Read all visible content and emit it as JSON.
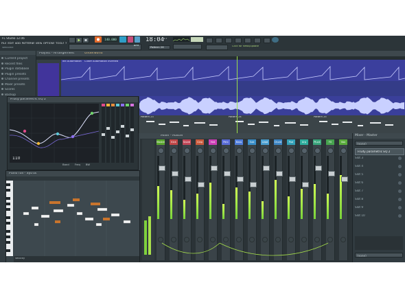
{
  "topbar": {
    "menu": [
      "FILE",
      "EDIT",
      "ADD",
      "PATTERNS",
      "VIEW",
      "OPTIONS",
      "TOOLS",
      "?"
    ],
    "project_title": "FL Studio 12.0b",
    "hint": "Welcome",
    "tempo_display": "140.000",
    "time_display": "18:04",
    "time_sub": "27",
    "pattern_label": "Pattern 26",
    "online_text": "Click for news/update"
  },
  "browser": {
    "items": [
      "Current project",
      "Recent files",
      "Plugin database",
      "Plugin presets",
      "Channel presets",
      "Mixer presets",
      "Scores",
      "Backup",
      "Clipboard files",
      "Collected",
      "Envelopes",
      "IL shared data",
      "Impulses",
      "Misc",
      "Packs",
      "Project bones",
      "Projects",
      "Recorded",
      "Rendered",
      "Sliced beats",
      "Soundfonts",
      "Speech",
      "User"
    ]
  },
  "playlist": {
    "title": "Playlist - Arrangement",
    "breadcrumb": "Underworld",
    "automation_clip_1": "Init Automation",
    "automation_clip_2": "Cutoff Automation Inverted",
    "pattern_label_1": "Pattern 23",
    "pattern_label_2": "Pattern 24",
    "pattern_label_3": "Pattern 25"
  },
  "eq": {
    "title": "Fruity parametric EQ 2",
    "readout": "110",
    "bottom_labels": [
      "Band",
      "Freq",
      "BW"
    ]
  },
  "pianoroll": {
    "title": "Piano roll - Sytrus",
    "subtitle": "Velocity",
    "keyboard_label": "C5"
  },
  "mixer": {
    "title": "Mixer - Master",
    "channels": [
      {
        "name": "Master",
        "color": "#5aa52f"
      },
      {
        "name": "Kick",
        "color": "#c04848"
      },
      {
        "name": "Snare",
        "color": "#c04858"
      },
      {
        "name": "Clap",
        "color": "#c95a3d"
      },
      {
        "name": "Hat",
        "color": "#cc3fb6"
      },
      {
        "name": "Perc",
        "color": "#5a6dd8"
      },
      {
        "name": "Bass",
        "color": "#4f7cd9"
      },
      {
        "name": "Sub",
        "color": "#3a8fc9"
      },
      {
        "name": "Lead",
        "color": "#4b9fd0"
      },
      {
        "name": "Chord",
        "color": "#3d86c4"
      },
      {
        "name": "Pad",
        "color": "#33a1b8"
      },
      {
        "name": "Arp",
        "color": "#2fae9e"
      },
      {
        "name": "Pluck",
        "color": "#3aa57c"
      },
      {
        "name": "FX",
        "color": "#47a34f"
      },
      {
        "name": "Vox",
        "color": "#5aab3c"
      },
      {
        "name": "Ins 16",
        "color": "#6fb237"
      }
    ],
    "levels": [
      0.52,
      0.46,
      0.3,
      0.4,
      0.58,
      0.24,
      0.5,
      0.44,
      0.28,
      0.62,
      0.36,
      0.48,
      0.55,
      0.4,
      0.7,
      0.42
    ]
  },
  "inspector": {
    "title": "Mixer - Master",
    "preset": "(none)",
    "effect_1": "Fruity parametric EQ 2",
    "slots": [
      "Slot 3",
      "Slot 4",
      "Slot 5",
      "Slot 6",
      "Slot 7",
      "Slot 8",
      "Slot 9",
      "Slot 10"
    ],
    "footer": "(none)"
  },
  "colors": {
    "accent_green": "#a7e04b",
    "playlist_blue": "#3b3f9d",
    "waveform": "#c9d0ff",
    "eq_bg": "#1d2126"
  }
}
